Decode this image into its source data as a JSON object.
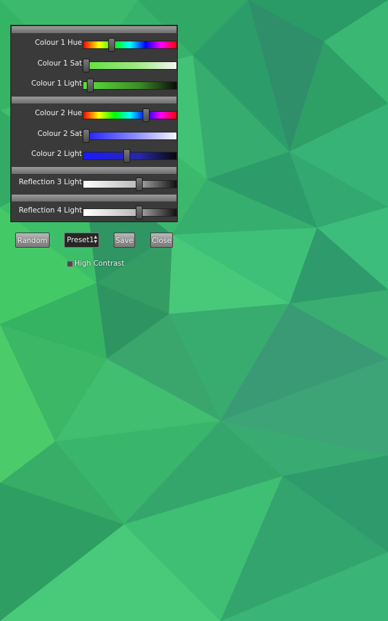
{
  "sliders": [
    {
      "label": "Colour 1 Hue",
      "value": 0.31,
      "track": "hue"
    },
    {
      "label": "Colour 1 Sat",
      "value": 0.04,
      "track": "sat1"
    },
    {
      "label": "Colour 1 Light",
      "value": 0.08,
      "track": "light1"
    },
    {
      "label": "Colour 2 Hue",
      "value": 0.67,
      "track": "hue"
    },
    {
      "label": "Colour 2 Sat",
      "value": 0.04,
      "track": "sat2"
    },
    {
      "label": "Colour 2 Light",
      "value": 0.47,
      "track": "light2"
    },
    {
      "label": "Reflection 3 Light",
      "value": 0.6,
      "track": "grey"
    },
    {
      "label": "Reflection 4 Light",
      "value": 0.6,
      "track": "grey"
    }
  ],
  "buttons": {
    "random": "Random",
    "save": "Save",
    "close": "Close"
  },
  "preset": {
    "value": "Preset1"
  },
  "high_contrast": {
    "label": "High Contrast",
    "checked": false
  },
  "colors": {
    "background": "#2e9e62",
    "colour1": "#5ee03c",
    "colour2": "#1a1aff"
  }
}
